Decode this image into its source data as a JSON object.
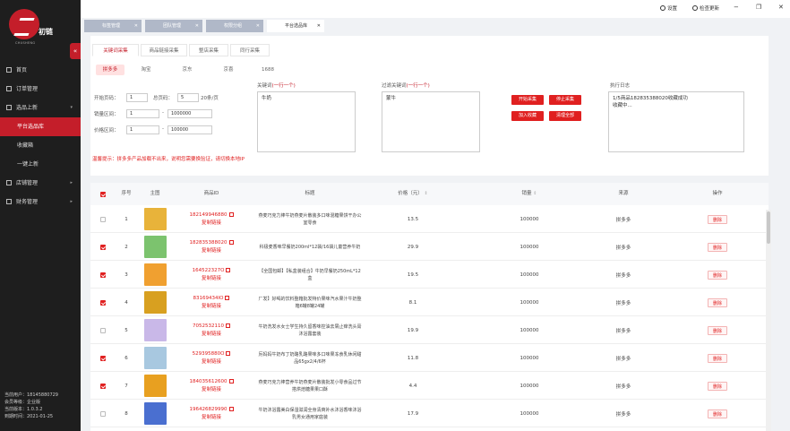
{
  "brand": {
    "name": "初链",
    "en": "CHUSHENG",
    "color": "#c41e2a"
  },
  "sidebar": {
    "items": [
      {
        "label": "首页",
        "icon": "home-icon",
        "type": "top"
      },
      {
        "label": "订单管理",
        "icon": "order-icon",
        "type": "top"
      },
      {
        "label": "选品上新",
        "icon": "product-icon",
        "type": "top",
        "caret": "▾"
      },
      {
        "label": "平台选品库",
        "type": "sub",
        "active": true
      },
      {
        "label": "收藏箱",
        "type": "sub"
      },
      {
        "label": "一键上新",
        "type": "sub"
      },
      {
        "label": "店铺管理",
        "icon": "shop-icon",
        "type": "top",
        "caret": "▸"
      },
      {
        "label": "财务管理",
        "icon": "finance-icon",
        "type": "top",
        "caret": "▸"
      }
    ],
    "user": {
      "line1": "当前用户：18145880729",
      "line2": "会员等级：企业版",
      "line3": "当前版本：1.0.3.2",
      "line4": "到期时间：2021-01-25"
    }
  },
  "topbar": {
    "settings": "设置",
    "update": "检查更新",
    "minimize": "−",
    "maximize": "❐",
    "close": "✕"
  },
  "page_tabs": [
    {
      "label": "标签管理",
      "active": false
    },
    {
      "label": "团队管理",
      "active": false
    },
    {
      "label": "权限分组",
      "active": false
    },
    {
      "label": "平台选品库",
      "active": true
    }
  ],
  "filter": {
    "sub_tabs": [
      "关键词采集",
      "商品链接采集",
      "整店采集",
      "同行采集"
    ],
    "platforms": [
      "拼多多",
      "淘宝",
      "京东",
      "京喜",
      "1688"
    ],
    "start_page_label": "开始页码：",
    "start_page": "1",
    "total_page_label": "总页码：",
    "total_page": "5",
    "per_page": "20条/页",
    "sales_label": "销量区间：",
    "sales_min": "1",
    "sales_max": "1000000",
    "price_label": "价格区间：",
    "price_min": "1",
    "price_max": "100000",
    "range_sep": "-",
    "keyword_label": "关键词",
    "keyword_hint": "(一行一个)",
    "keyword_value": "牛奶",
    "exclude_label": "过滤关键词",
    "exclude_hint": "(一行一个)",
    "exclude_value": "蒙牛",
    "buttons": {
      "start": "开始采集",
      "stop": "停止采集",
      "collect": "加入收藏",
      "clear": "清理全部"
    },
    "log_label": "执行日志",
    "log_line1": "1/5商品182835388020收藏成功",
    "log_line2": "收藏中...",
    "warning": "温馨提示：拼多多产品加载不出来，说明您需要换验证，请切换本地IP"
  },
  "table": {
    "headers": {
      "seq": "序号",
      "image": "主图",
      "id": "商品ID",
      "title": "标题",
      "price": "价格（元）",
      "sales": "销量",
      "source": "来源",
      "action": "操作"
    },
    "sort_glyph": "⇕",
    "copy_label": "复制链接",
    "delete_label": "删除",
    "rows": [
      {
        "seq": "1",
        "id": "182149946880",
        "title": "燕麦巧克力棒牛奶燕麦片散装多口味混糖果饼干办公室零食",
        "price": "13.5",
        "sales": "100000",
        "source": "拼多多",
        "checked": false,
        "thumb": "#e8b33a"
      },
      {
        "seq": "2",
        "id": "182835388020",
        "title": "科极麦香味早餐奶200ml*12袋/16袋儿童营养牛奶",
        "price": "29.9",
        "sales": "100000",
        "source": "拼多多",
        "checked": true,
        "thumb": "#7cc36e"
      },
      {
        "seq": "3",
        "id": "164522327O",
        "title": "【全国包邮】【私盒装组合】牛奶早餐奶250mL*12盒",
        "price": "19.5",
        "sales": "100000",
        "source": "拼多多",
        "checked": true,
        "thumb": "#f0a030"
      },
      {
        "seq": "4",
        "id": "83169434IO",
        "title": "厂发】好喝的饮料整箱批发特价果味汽水果汁牛奶整箱6罐8罐24罐",
        "price": "8.1",
        "sales": "100000",
        "source": "拼多多",
        "checked": true,
        "thumb": "#d8a020"
      },
      {
        "seq": "5",
        "id": "7052532110",
        "title": "牛奶洗发水女士学生持久留香味控油去屑止痒洗头膏沐浴露套装",
        "price": "19.9",
        "sales": "100000",
        "source": "拼多多",
        "checked": false,
        "thumb": "#c9b8e8"
      },
      {
        "seq": "6",
        "id": "529395880O",
        "title": "厉妈妈牛奶布丁奶酪乳酪果味多口味果冻食乳休闲甜品65gx2/4/6杯",
        "price": "11.8",
        "sales": "100000",
        "source": "拼多多",
        "checked": true,
        "thumb": "#a8c8e0"
      },
      {
        "seq": "7",
        "id": "184035612600",
        "title": "燕麦巧克力棒营养牛奶燕麦片散装批发小零食品过节搭烘焙糖果果口酥",
        "price": "4.4",
        "sales": "100000",
        "source": "拼多多",
        "checked": true,
        "thumb": "#e8a020"
      },
      {
        "seq": "8",
        "id": "196426829990",
        "title": "牛奶沐浴露美白保湿滋润全身清爽补水沐浴香味沐浴乳男女通用家庭装",
        "price": "17.9",
        "sales": "100000",
        "source": "拼多多",
        "checked": false,
        "thumb": "#4a6fd0"
      }
    ]
  }
}
